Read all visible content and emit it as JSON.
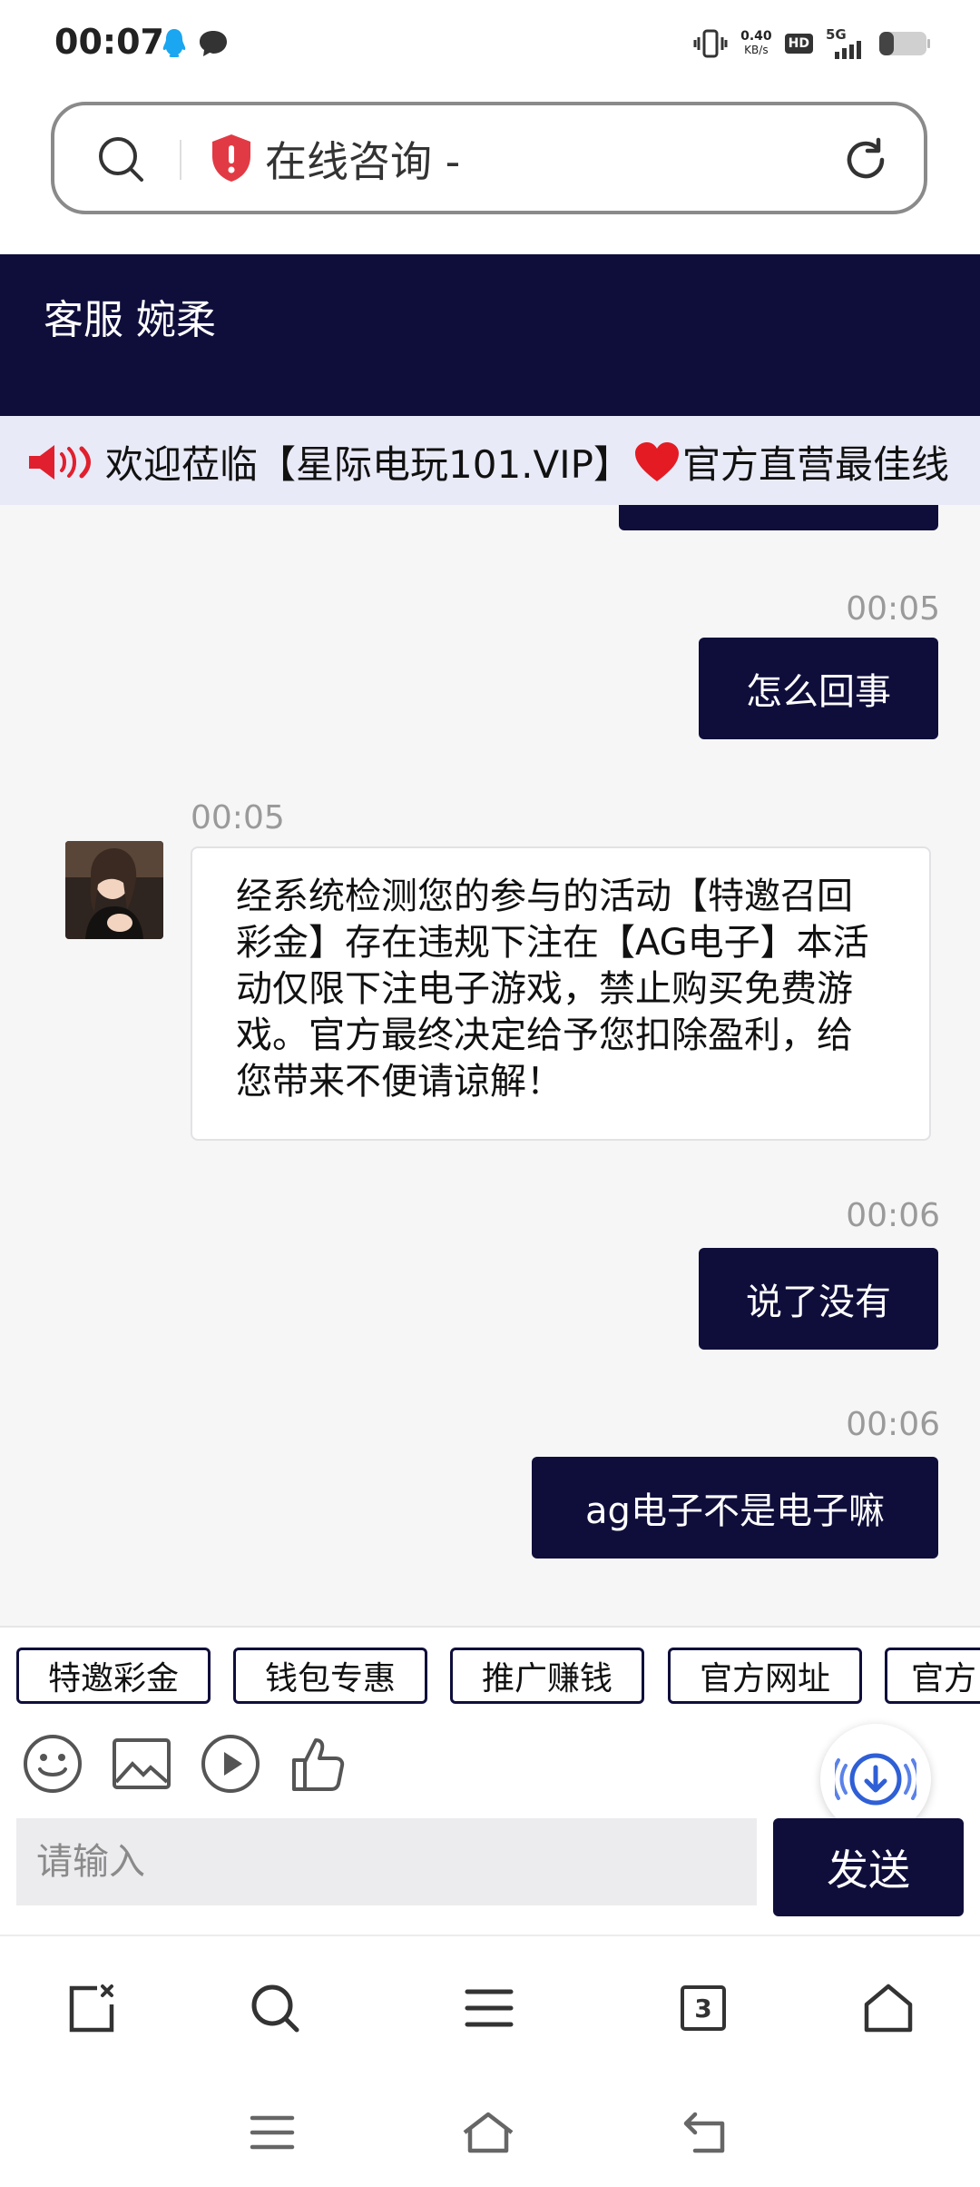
{
  "status_bar": {
    "time": "00:07",
    "net_speed_value": "0.40",
    "net_speed_unit": "KB/s",
    "hd_badge": "HD",
    "signal_label": "5G",
    "icons": [
      "qq-icon",
      "message-icon",
      "vibrate-icon",
      "hd-icon",
      "signal-icon",
      "battery-icon"
    ]
  },
  "browser": {
    "url_text": "在线咨询 -",
    "icons": [
      "search-icon",
      "shield-alert-icon",
      "reload-icon"
    ]
  },
  "chat": {
    "header_title": "客服 婉柔",
    "marquee_text": "欢迎莅临【星际电玩101.VIP】",
    "marquee_text_2": "官方直营最佳线",
    "messages": [
      {
        "side": "out",
        "time": "00:05",
        "text": "怎么回事"
      },
      {
        "side": "in",
        "time": "00:05",
        "text": "经系统检测您的参与的活动【特邀召回彩金】存在违规下注在【AG电子】本活动仅限下注电子游戏，禁止购买免费游戏。官方最终决定给予您扣除盈利，给您带来不便请谅解！"
      },
      {
        "side": "out",
        "time": "00:06",
        "text": "说了没有"
      },
      {
        "side": "out",
        "time": "00:06",
        "text": "ag电子不是电子嘛"
      }
    ],
    "quick_chips": [
      "特邀彩金",
      "钱包专惠",
      "推广赚钱",
      "官方网址",
      "官方"
    ],
    "input_placeholder": "请输入",
    "send_label": "发送",
    "accent_color": "#0f0e3b"
  },
  "browser_bottom": {
    "tab_count": "3",
    "icons": [
      "close-tab-icon",
      "search-icon",
      "menu-icon",
      "tabs-icon",
      "home-icon"
    ]
  },
  "system_nav": {
    "icons": [
      "recent-apps-icon",
      "home-icon",
      "back-icon"
    ]
  }
}
